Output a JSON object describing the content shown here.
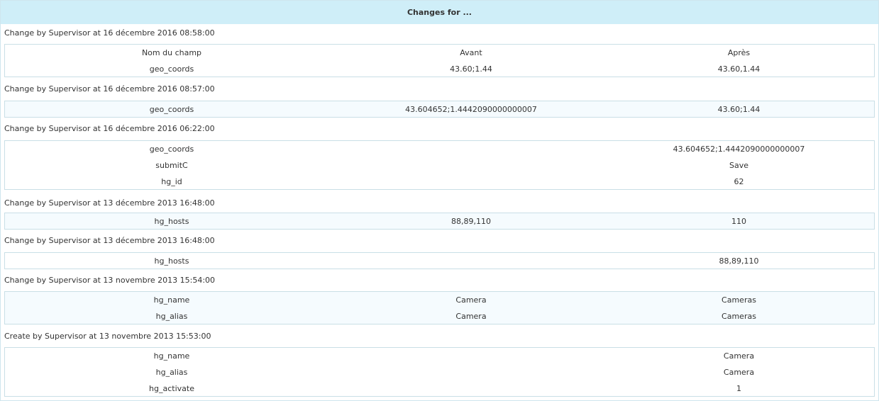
{
  "page": {
    "title": "Changes for ..."
  },
  "columns": [
    "Nom du champ",
    "Avant",
    "Après"
  ],
  "entries": [
    {
      "header": "Change by Supervisor at 16 décembre 2016 08:58:00",
      "rows": [
        [
          "Nom du champ",
          "Avant",
          "Après"
        ],
        [
          "geo_coords",
          "43.60;1.44",
          "43.60,1.44"
        ]
      ]
    },
    {
      "header": "Change by Supervisor at 16 décembre 2016 08:57:00",
      "rows": [
        [
          "geo_coords",
          "43.604652;1.4442090000000007",
          "43.60;1.44"
        ]
      ]
    },
    {
      "header": "Change by Supervisor at 16 décembre 2016 06:22:00",
      "rows": [
        [
          "geo_coords",
          "",
          "43.604652;1.4442090000000007"
        ],
        [
          "submitC",
          "",
          "Save"
        ],
        [
          "hg_id",
          "",
          "62"
        ]
      ]
    },
    {
      "header": "Change by Supervisor at 13 décembre 2013 16:48:00",
      "rows": [
        [
          "hg_hosts",
          "88,89,110",
          "110"
        ]
      ]
    },
    {
      "header": "Change by Supervisor at 13 décembre 2013 16:48:00",
      "rows": [
        [
          "hg_hosts",
          "",
          "88,89,110"
        ]
      ]
    },
    {
      "header": "Change by Supervisor at 13 novembre 2013 15:54:00",
      "rows": [
        [
          "hg_name",
          "Camera",
          "Cameras"
        ],
        [
          "hg_alias",
          "Camera",
          "Cameras"
        ]
      ]
    },
    {
      "header": "Create by Supervisor at 13 novembre 2013 15:53:00",
      "rows": [
        [
          "hg_name",
          "",
          "Camera"
        ],
        [
          "hg_alias",
          "",
          "Camera"
        ],
        [
          "hg_activate",
          "",
          "1"
        ]
      ]
    }
  ]
}
